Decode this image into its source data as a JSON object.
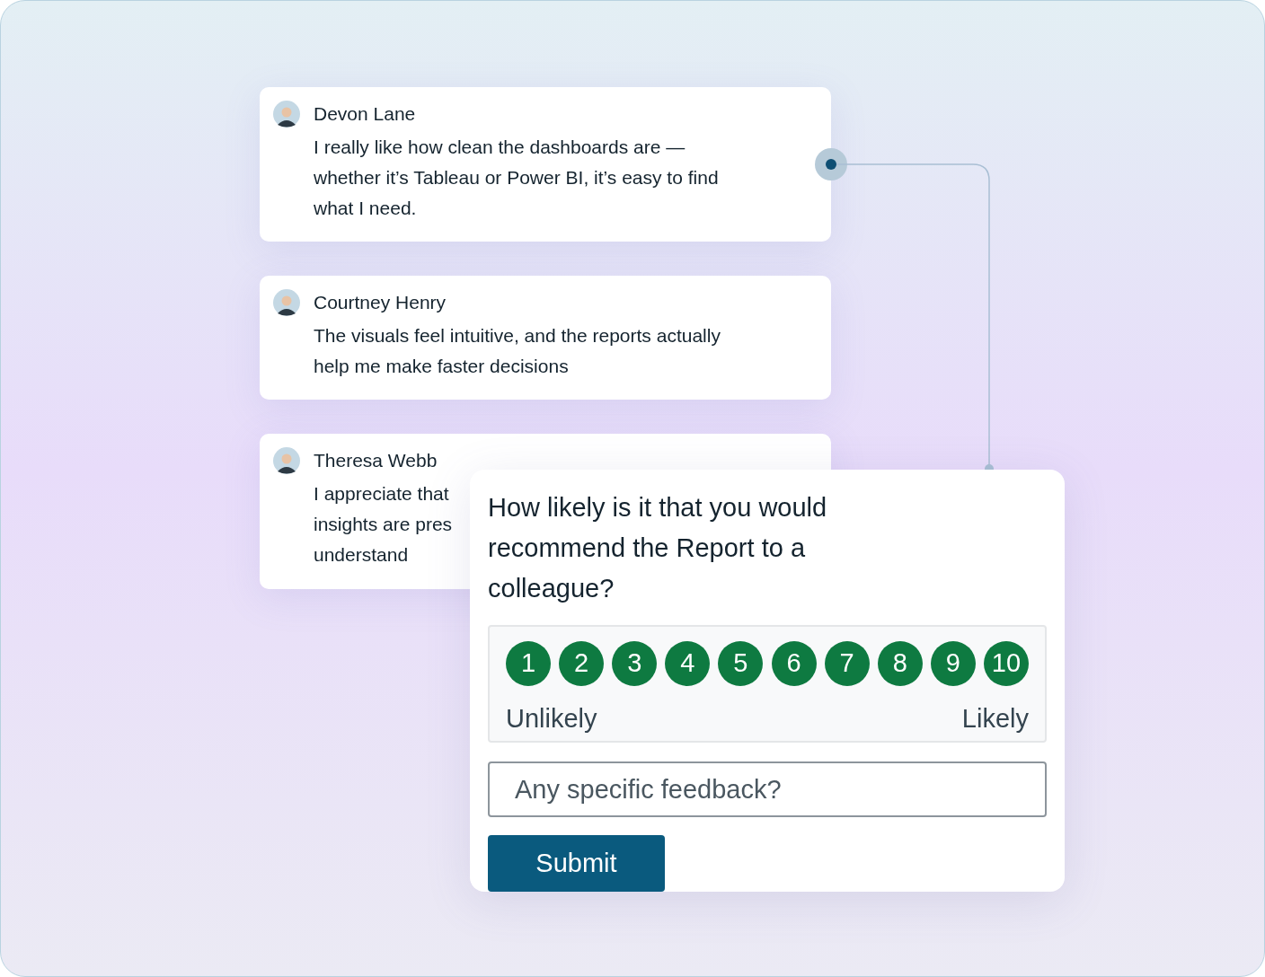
{
  "testimonials": [
    {
      "name": "Devon Lane",
      "comment_lines": [
        "I really like how clean the dashboards are —",
        "whether it’s Tableau or Power BI, it’s easy to find",
        "what I need."
      ]
    },
    {
      "name": "Courtney Henry",
      "comment_lines": [
        "The visuals feel intuitive, and the reports actually",
        "help me make faster decisions"
      ]
    },
    {
      "name": "Theresa Webb",
      "comment_lines": [
        "I appreciate that",
        "insights are pres",
        "understand"
      ]
    }
  ],
  "survey": {
    "question": "How likely is it that you would recommend the Report to a colleague?",
    "scores": [
      "1",
      "2",
      "3",
      "4",
      "5",
      "6",
      "7",
      "8",
      "9",
      "10"
    ],
    "low_label": "Unlikely",
    "high_label": "Likely",
    "feedback": {
      "placeholder": "Any specific feedback?"
    },
    "submit": "Submit"
  }
}
